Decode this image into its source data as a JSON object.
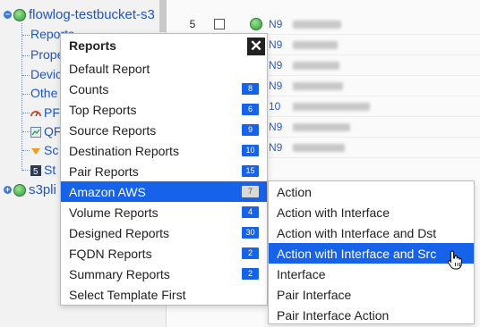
{
  "tree": {
    "root_label": "flowlog-testbucket-s3",
    "children": [
      "Reports",
      "Prope",
      "Devic",
      "Othe",
      "PF",
      "QF",
      "Sc",
      "St"
    ],
    "sibling_label": "s3pli"
  },
  "table": {
    "rows": [
      {
        "num": "5",
        "id": "N9"
      },
      {
        "num": "",
        "id": "N9"
      },
      {
        "num": "",
        "id": "N9"
      },
      {
        "num": "",
        "id": "N9"
      },
      {
        "num": "",
        "id": "10"
      },
      {
        "num": "",
        "id": "N9"
      },
      {
        "num": "",
        "id": "N9"
      }
    ]
  },
  "popup": {
    "title": "Reports",
    "close_glyph": "✕",
    "items": [
      {
        "label": "Default Report",
        "badge": ""
      },
      {
        "label": "Counts",
        "badge": "8"
      },
      {
        "label": "Top Reports",
        "badge": "6"
      },
      {
        "label": "Source Reports",
        "badge": "9"
      },
      {
        "label": "Destination Reports",
        "badge": "10"
      },
      {
        "label": "Pair Reports",
        "badge": "15"
      },
      {
        "label": "Amazon AWS",
        "badge": "7"
      },
      {
        "label": "Volume Reports",
        "badge": "4"
      },
      {
        "label": "Designed Reports",
        "badge": "30"
      },
      {
        "label": "FQDN Reports",
        "badge": "2"
      },
      {
        "label": "Summary Reports",
        "badge": "2"
      },
      {
        "label": "Select Template First",
        "badge": ""
      }
    ],
    "active_index": 6
  },
  "submenu": {
    "items": [
      "Action",
      "Action with Interface",
      "Action with Interface and Dst",
      "Action with Interface and Src",
      "Interface",
      "Pair Interface",
      "Pair Interface Action"
    ],
    "active_index": 3
  },
  "colors": {
    "accent": "#1662e8",
    "link": "#1e54c9"
  }
}
